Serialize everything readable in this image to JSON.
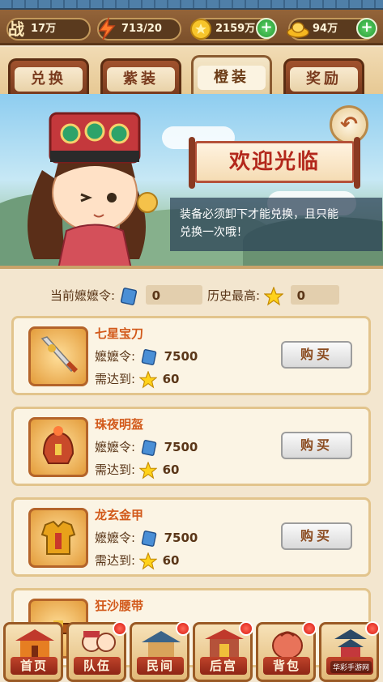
{
  "resources": {
    "power": {
      "icon": "war-power-icon",
      "value": "17万",
      "glyph": "战"
    },
    "stamina": {
      "icon": "lightning-icon",
      "value": "713/20"
    },
    "coins": {
      "icon": "coin-icon",
      "value": "2159万"
    },
    "ingots": {
      "icon": "gold-ingot-icon",
      "value": "94万"
    }
  },
  "tabs": [
    {
      "label": "兑换",
      "active": false
    },
    {
      "label": "紫装",
      "active": false
    },
    {
      "label": "橙装",
      "active": true
    },
    {
      "label": "奖励",
      "active": false
    }
  ],
  "banner": {
    "welcome": "欢迎光临",
    "notice_line1": "装备必须卸下才能兑换，且只能",
    "notice_line2": "兑换一次哦！",
    "back_icon": "back-arrow-icon"
  },
  "currency": {
    "current_label": "当前嬷嬷令:",
    "current_value": "0",
    "history_label": "历史最高:",
    "history_value": "0"
  },
  "items": [
    {
      "name": "七星宝刀",
      "cost_label": "嬷嬷令:",
      "cost": "7500",
      "req_label": "需达到:",
      "req": "60",
      "buy": "购买",
      "icon": "sword-icon"
    },
    {
      "name": "珠夜明盔",
      "cost_label": "嬷嬷令:",
      "cost": "7500",
      "req_label": "需达到:",
      "req": "60",
      "buy": "购买",
      "icon": "helmet-icon"
    },
    {
      "name": "龙玄金甲",
      "cost_label": "嬷嬷令:",
      "cost": "7500",
      "req_label": "需达到:",
      "req": "60",
      "buy": "购买",
      "icon": "armor-icon"
    },
    {
      "name": "狂沙腰带",
      "icon": "belt-icon"
    }
  ],
  "nav": [
    {
      "label": "首页",
      "icon": "palace-icon",
      "badge": false
    },
    {
      "label": "队伍",
      "icon": "team-icon",
      "badge": true
    },
    {
      "label": "民间",
      "icon": "folk-house-icon",
      "badge": true
    },
    {
      "label": "后宫",
      "icon": "harem-gate-icon",
      "badge": true
    },
    {
      "label": "背包",
      "icon": "bag-icon",
      "badge": true
    },
    {
      "label": "",
      "icon": "temple-icon",
      "badge": true
    }
  ],
  "watermark": "华彩手游网"
}
